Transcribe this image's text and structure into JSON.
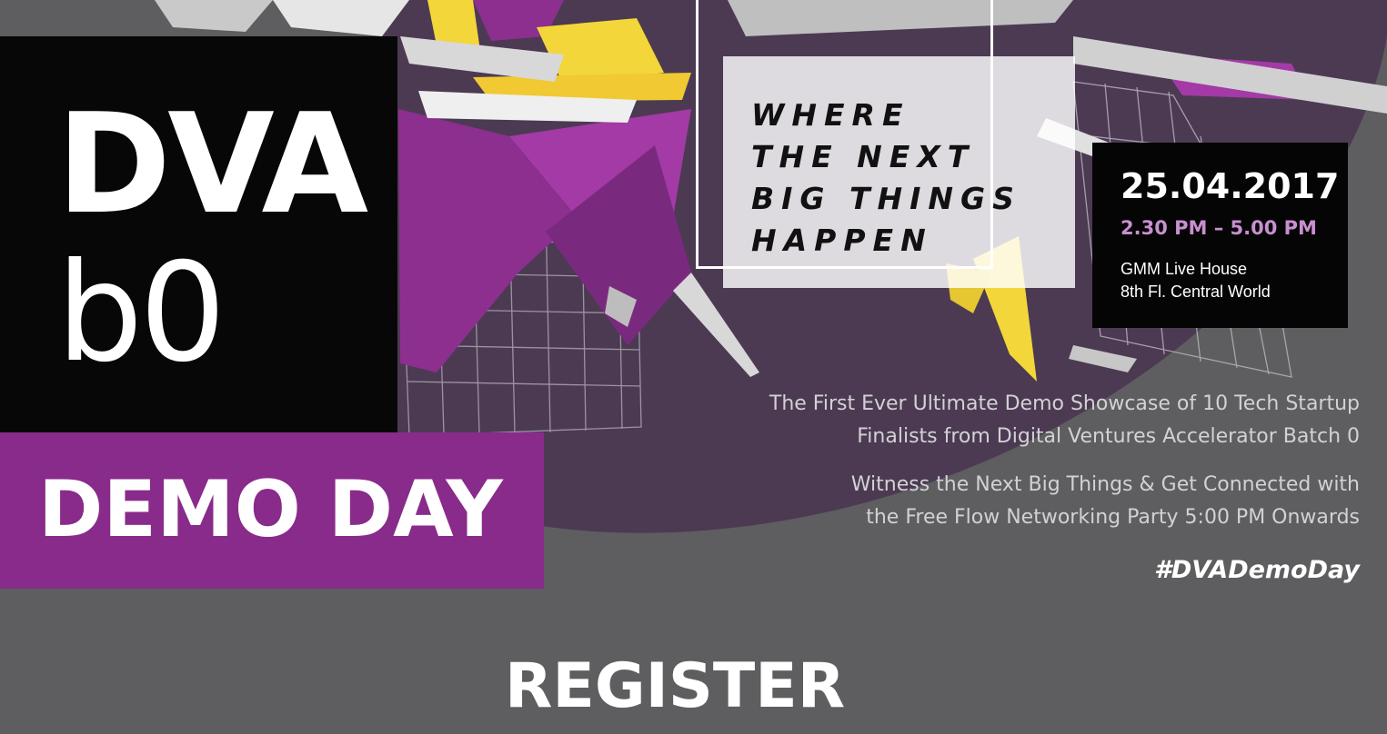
{
  "brand": {
    "title": "DVA",
    "batch": "b0",
    "event_name": "DEMO DAY"
  },
  "tagline": [
    "WHERE",
    "THE NEXT",
    "BIG THINGS",
    "HAPPEN"
  ],
  "event": {
    "date": "25.04.2017",
    "time": "2.30 PM – 5.00 PM",
    "venue_lines": [
      "GMM Live House",
      "8th Fl. Central World"
    ]
  },
  "description": [
    "The First Ever Ultimate Demo Showcase of 10 Tech Startup",
    "Finalists from Digital Ventures Accelerator Batch 0",
    "Witness the Next Big Things & Get Connected with",
    "the Free Flow Networking Party 5:00 PM Onwards"
  ],
  "hashtag": "#DVADemoDay",
  "register_label": "REGISTER",
  "colors": {
    "background": "#5e5e60",
    "dark_circle": "#4c3a53",
    "brand_purple": "#882b8a",
    "accent_yellow": "#f3d63a",
    "time_purple": "#c98fd0",
    "black_box": "#070707"
  }
}
